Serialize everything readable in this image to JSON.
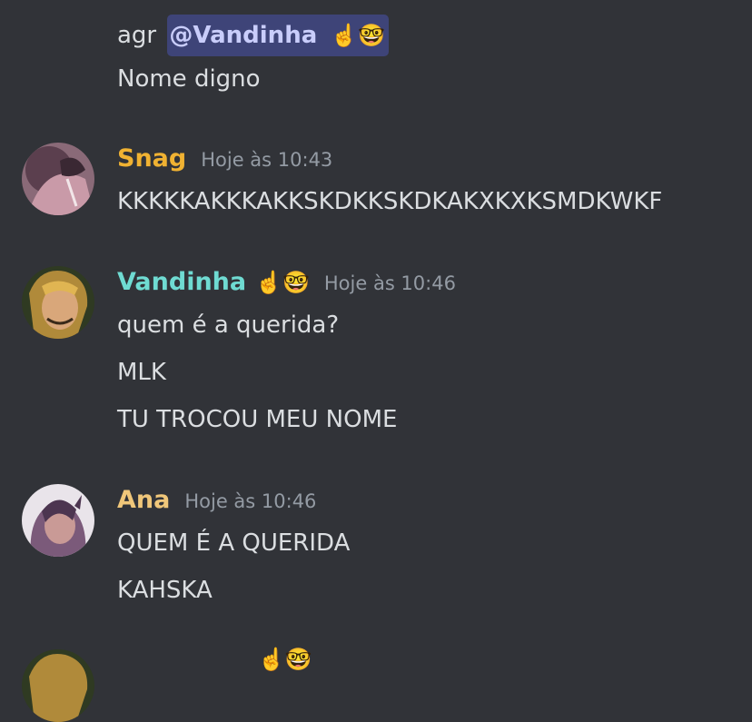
{
  "prev_message": {
    "line1_prefix": "agr",
    "mention": "@Vandinha",
    "mention_emojis": "☝️🤓",
    "line2": "Nome digno"
  },
  "messages": [
    {
      "author": "Snag",
      "author_color": "#f0b232",
      "time": "Hoje às 10:43",
      "lines": [
        "KKKKKAKKKAKKSKDKKSKDKAKXKXKSMDKWKF"
      ]
    },
    {
      "author": "Vandinha",
      "author_emojis": "☝️🤓",
      "author_color": "#6fdbd2",
      "time": "Hoje às 10:46",
      "lines": [
        "quem é a querida?",
        "MLK",
        "TU TROCOU MEU NOME"
      ]
    },
    {
      "author": "Ana",
      "author_color": "#f0c77a",
      "time": "Hoje às 10:46",
      "lines": [
        "QUEM É A QUERIDA",
        "KAHSKA"
      ]
    }
  ],
  "icons": {
    "pointing_up": "☝️",
    "nerd_face": "🤓"
  }
}
